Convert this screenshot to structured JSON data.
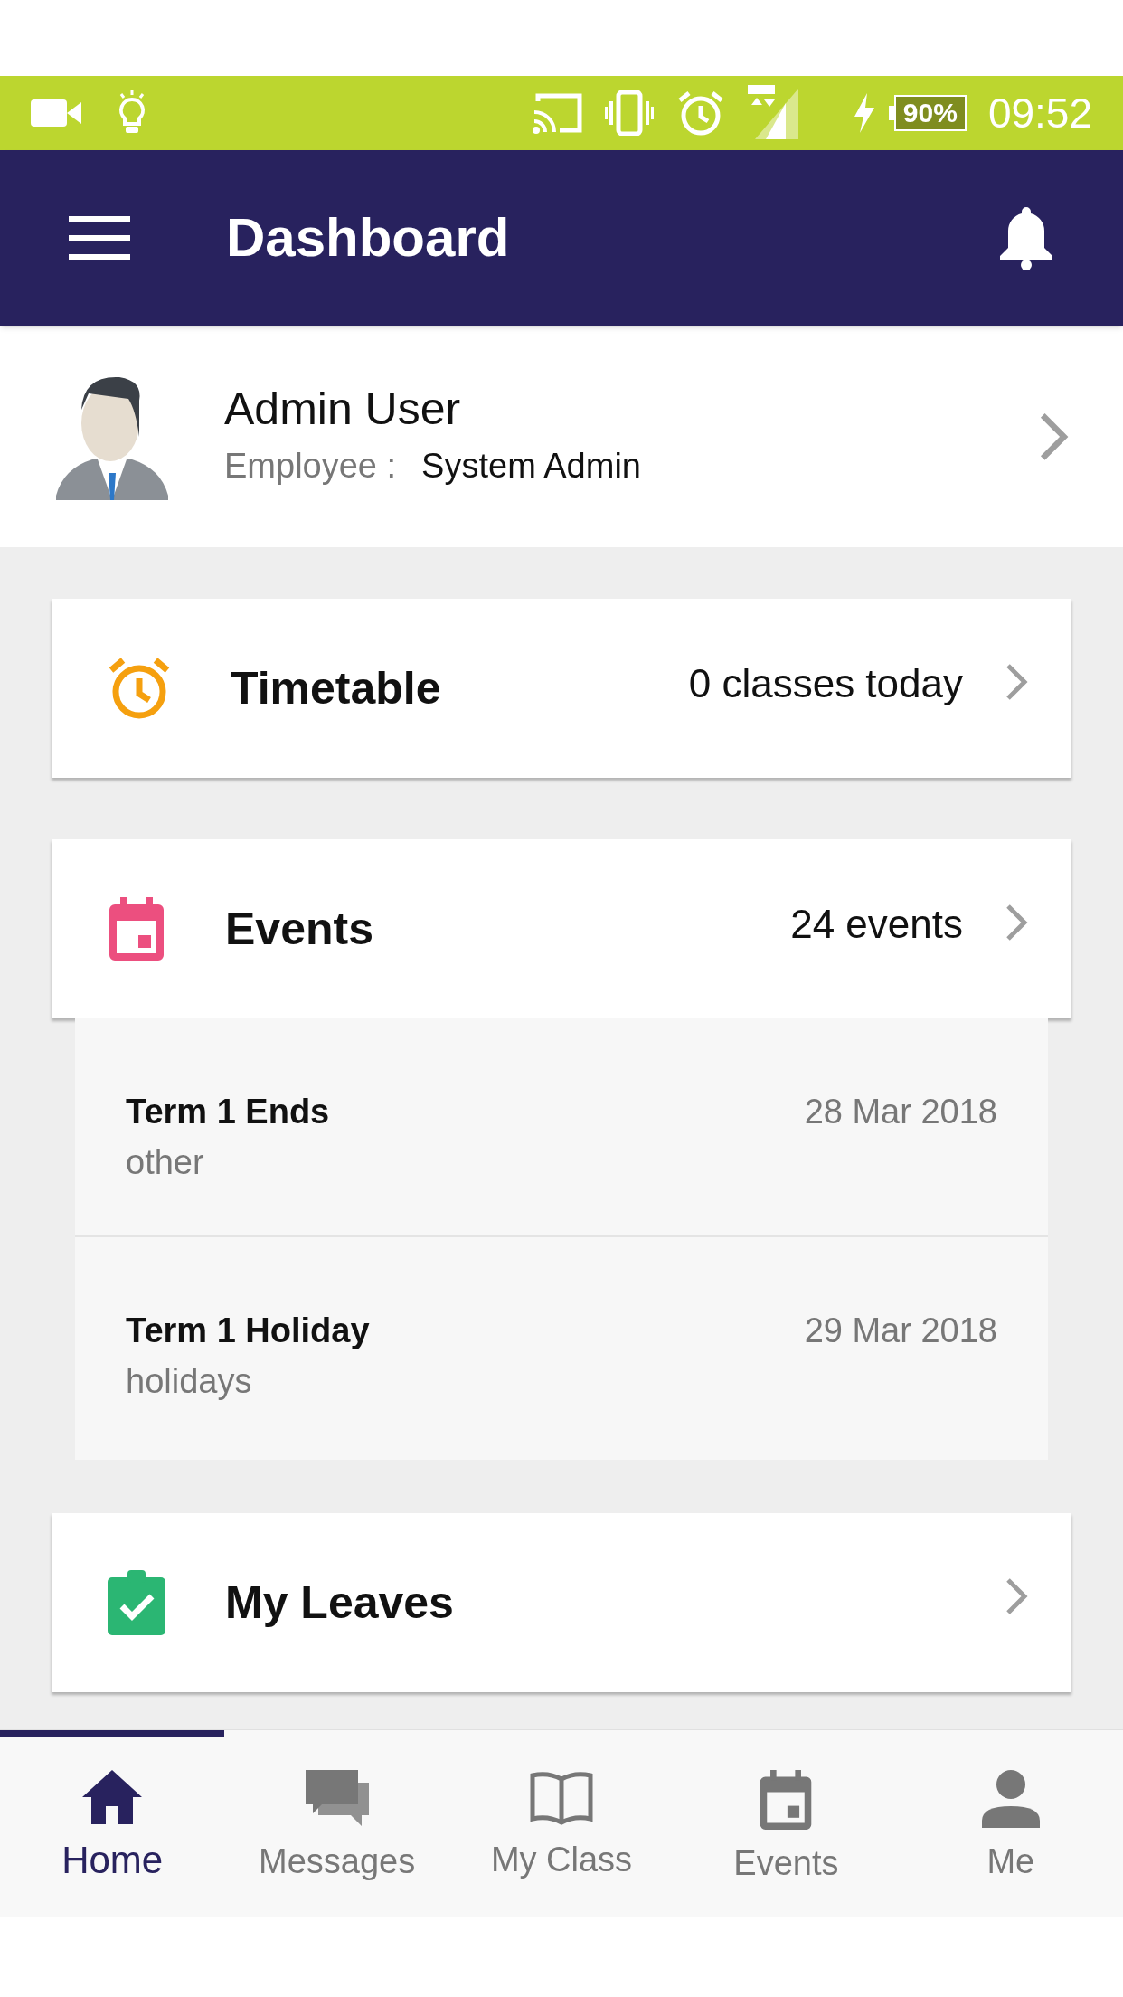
{
  "status_bar": {
    "battery": "90%",
    "time": "09:52"
  },
  "app_bar": {
    "title": "Dashboard"
  },
  "profile": {
    "name": "Admin User",
    "role_label": "Employee :",
    "role": "System Admin"
  },
  "cards": [
    {
      "kind": "timetable",
      "title": "Timetable",
      "summary": "0 classes today",
      "color": "#f5a00f"
    },
    {
      "kind": "events",
      "title": "Events",
      "summary": "24 events",
      "color": "#ec4f7f",
      "items": [
        {
          "title": "Term 1 Ends",
          "category": "other",
          "date": "28 Mar 2018"
        },
        {
          "title": "Term 1 Holiday",
          "category": "holidays",
          "date": "29 Mar 2018"
        }
      ]
    },
    {
      "kind": "leaves",
      "title": "My Leaves",
      "color": "#2bb673"
    }
  ],
  "bottom_nav": [
    {
      "kind": "home",
      "label": "Home",
      "selected": true
    },
    {
      "kind": "messages",
      "label": "Messages",
      "selected": false
    },
    {
      "kind": "class",
      "label": "My Class",
      "selected": false
    },
    {
      "kind": "events",
      "label": "Events",
      "selected": false
    },
    {
      "kind": "me",
      "label": "Me",
      "selected": false
    }
  ]
}
